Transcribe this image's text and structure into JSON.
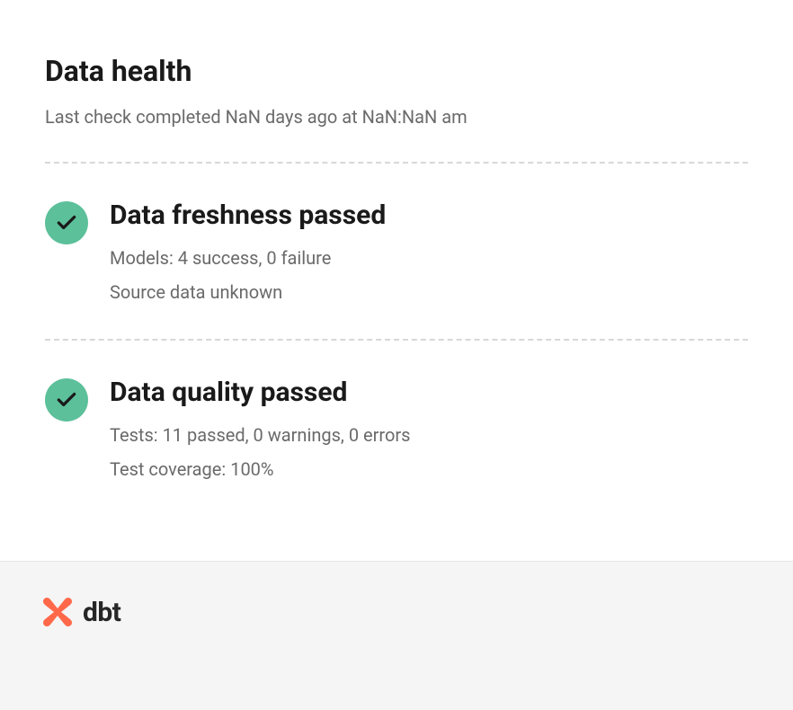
{
  "header": {
    "title": "Data health",
    "subtitle": "Last check completed NaN days ago at NaN:NaN am"
  },
  "checks": {
    "freshness": {
      "title": "Data freshness passed",
      "line1": "Models: 4 success, 0 failure",
      "line2": "Source data unknown"
    },
    "quality": {
      "title": "Data quality passed",
      "line1": "Tests: 11 passed, 0 warnings, 0 errors",
      "line2": "Test coverage: 100%"
    }
  },
  "footer": {
    "logo_text": "dbt"
  }
}
